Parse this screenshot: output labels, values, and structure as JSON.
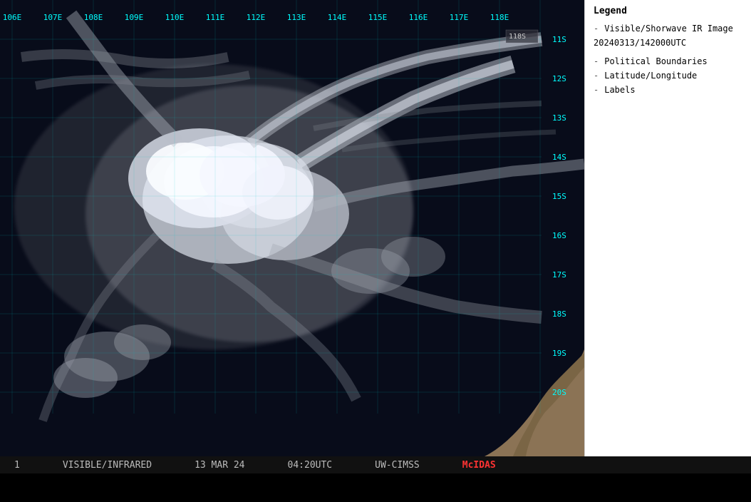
{
  "legend": {
    "title": "Legend",
    "image_label": "Visible/Shorwave IR Image",
    "timestamp": "20240313/142000UTC",
    "political_boundaries": "Political Boundaries",
    "lat_lon": "Latitude/Longitude",
    "labels": "Labels"
  },
  "grid": {
    "longitudes": [
      "106E",
      "107E",
      "108E",
      "109E",
      "110E",
      "111E",
      "112E",
      "113E",
      "114E",
      "115E",
      "116E",
      "117E",
      "118E"
    ],
    "latitudes": [
      "11S",
      "12S",
      "13S",
      "14S",
      "15S",
      "16S",
      "17S",
      "18S",
      "19S",
      "20S"
    ],
    "corner_box": "118s"
  },
  "status_bar": {
    "frame_number": "1",
    "product": "VISIBLE/INFRARED",
    "date": "13 MAR 24",
    "time": "04:20UTC",
    "source": "UW-CIMSS",
    "software": "McIDAS"
  }
}
